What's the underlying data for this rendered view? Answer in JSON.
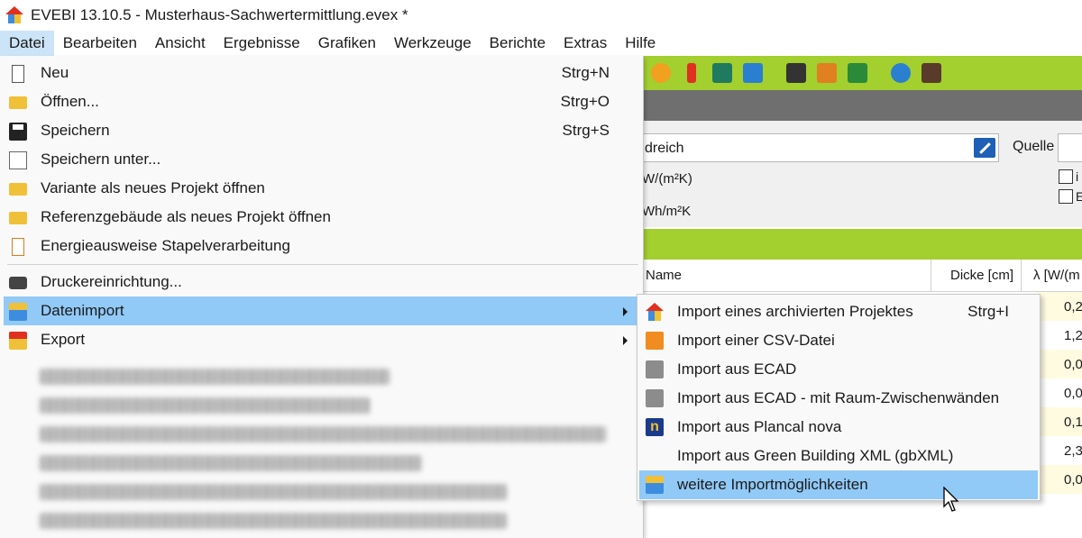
{
  "window": {
    "title": "EVEBI 13.10.5 - Musterhaus-Sachwertermittlung.evex *"
  },
  "menubar": [
    {
      "label": "Datei"
    },
    {
      "label": "Bearbeiten"
    },
    {
      "label": "Ansicht"
    },
    {
      "label": "Ergebnisse"
    },
    {
      "label": "Grafiken"
    },
    {
      "label": "Werkzeuge"
    },
    {
      "label": "Berichte"
    },
    {
      "label": "Extras"
    },
    {
      "label": "Hilfe"
    }
  ],
  "file_menu": {
    "items": [
      {
        "label": "Neu",
        "shortcut": "Strg+N",
        "icon": "new-document-icon"
      },
      {
        "label": "Öffnen...",
        "shortcut": "Strg+O",
        "icon": "open-folder-icon"
      },
      {
        "label": "Speichern",
        "shortcut": "Strg+S",
        "icon": "save-icon"
      },
      {
        "label": "Speichern unter...",
        "icon": "save-as-icon"
      },
      {
        "label": "Variante als neues Projekt öffnen",
        "icon": "variant-folder-icon"
      },
      {
        "label": "Referenzgebäude als neues Projekt öffnen",
        "icon": "reference-folder-icon"
      },
      {
        "label": "Energieausweise Stapelverarbeitung",
        "icon": "batch-document-icon"
      },
      {
        "label": "Druckereinrichtung...",
        "icon": "printer-icon"
      },
      {
        "label": "Datenimport",
        "icon": "import-icon",
        "has_submenu": true,
        "highlighted": true
      },
      {
        "label": "Export",
        "icon": "export-icon",
        "has_submenu": true
      }
    ]
  },
  "import_submenu": {
    "items": [
      {
        "label": "Import eines archivierten Projektes",
        "shortcut": "Strg+I",
        "icon": "house-icon"
      },
      {
        "label": "Import einer CSV-Datei",
        "icon": "csv-icon"
      },
      {
        "label": "Import aus ECAD",
        "icon": "ecad-icon"
      },
      {
        "label": "Import aus ECAD - mit Raum-Zwischenwänden",
        "icon": "ecad-icon"
      },
      {
        "label": "Import aus Plancal nova",
        "icon": "plancal-icon"
      },
      {
        "label": "Import aus Green Building XML (gbXML)",
        "icon": ""
      },
      {
        "label": "weitere Importmöglichkeiten",
        "icon": "import-icon",
        "highlighted": true
      }
    ]
  },
  "background": {
    "field_value": "dreich",
    "quelle_label": "Quelle",
    "unit_u": "W/(m²K)",
    "unit_e": "Wh/m²K",
    "checkbox1_text": "i",
    "checkbox2_text": "E",
    "table_headers": {
      "name": "Name",
      "dicke": "Dicke [cm]",
      "lambda": "λ [W/(m"
    },
    "table_values": [
      "0,2",
      "1,2",
      "0,0",
      "0,0",
      "0,1",
      "2,3",
      "0,0"
    ]
  },
  "colors": {
    "toolbar_green": "#a3cf2f",
    "highlight_blue": "#91c9f7",
    "menu_bg": "#f9f9f9"
  }
}
